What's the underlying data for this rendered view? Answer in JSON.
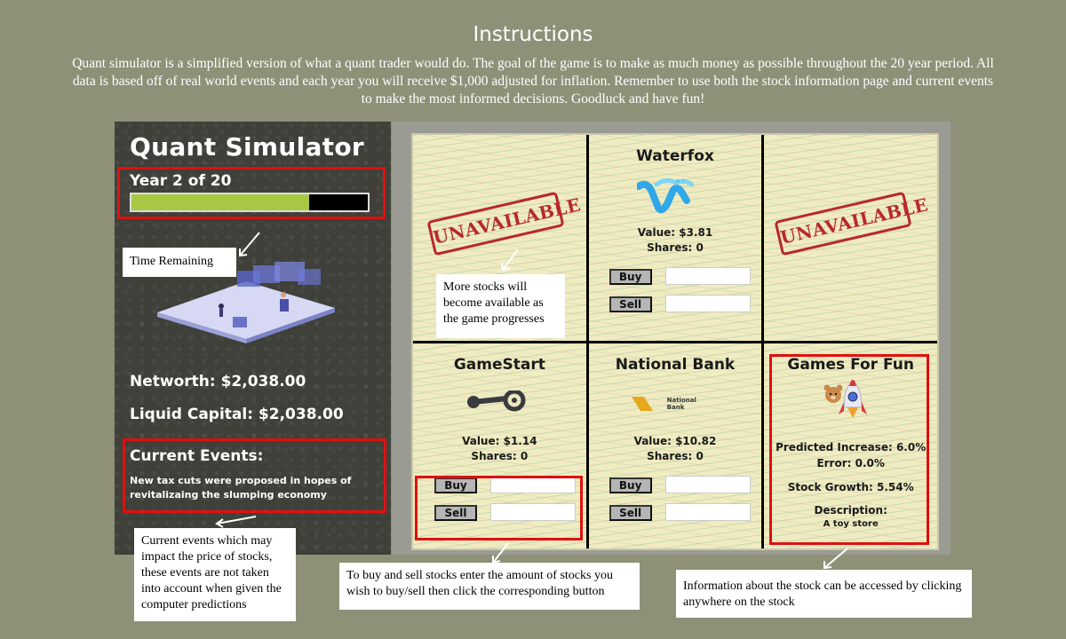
{
  "header": {
    "title": "Instructions",
    "intro": "Quant simulator is a simplified version of what a quant trader would do. The goal of the game is to make as much money as possible throughout the 20 year period. All data is based off of real world events and each year you will receive $1,000 adjusted for inflation. Remember to use both the stock information page and current events to make the most informed decisions. Goodluck and have fun!"
  },
  "sidebar": {
    "app_title": "Quant Simulator",
    "year_label": "Year 2 of 20",
    "year_progress": 0.75,
    "networth": "Networth: $2,038.00",
    "liquid_capital": "Liquid Capital: $2,038.00",
    "events_title": "Current Events:",
    "events_text": "New tax cuts were proposed in hopes of revitalizaing the slumping economy"
  },
  "stocks": {
    "unavailable_label": "UNAVAILABLE",
    "buy_label": "Buy",
    "sell_label": "Sell",
    "waterfox": {
      "name": "Waterfox",
      "value": "Value: $3.81",
      "shares": "Shares: 0"
    },
    "gamestart": {
      "name": "GameStart",
      "value": "Value: $1.14",
      "shares": "Shares: 0"
    },
    "national_bank": {
      "name": "National Bank",
      "value": "Value: $10.82",
      "shares": "Shares: 0",
      "logo_text": "National Bank"
    },
    "games_for_fun": {
      "name": "Games For Fun",
      "predicted": "Predicted Increase: 6.0%",
      "error": "Error: 0.0%",
      "growth": "Stock Growth: 5.54%",
      "description_label": "Description:",
      "description": "A toy store"
    }
  },
  "callouts": {
    "time_remaining": "Time Remaining",
    "more_stocks": "More stocks will become available as the game progresses",
    "current_events": "Current events which may impact the price of stocks, these events are not taken into account when given the computer predictions",
    "buy_sell": "To buy and sell stocks enter the amount of stocks you wish to buy/sell then click the corresponding button",
    "stock_info": "Information about the stock can be accessed by clicking anywhere on the stock"
  },
  "colors": {
    "background": "#8e9178",
    "panel": "#3e4039",
    "progress_fill": "#a8c843",
    "highlight": "#e01010",
    "stamp": "#b8282e"
  }
}
